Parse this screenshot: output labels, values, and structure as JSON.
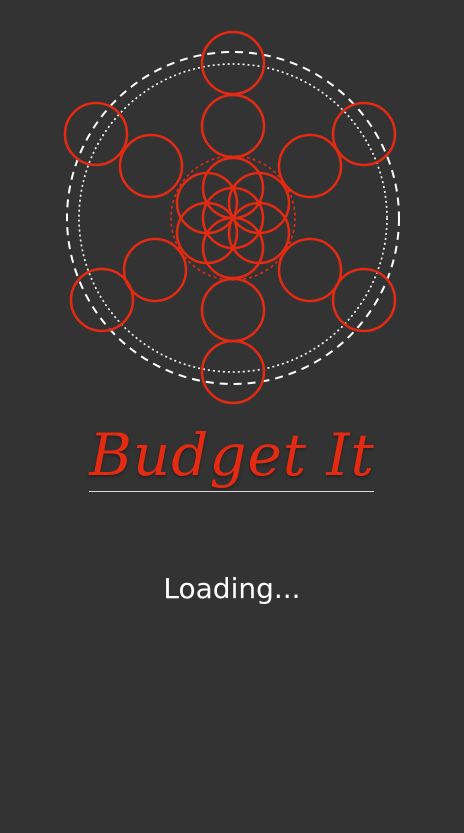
{
  "app": {
    "title": "Budget It",
    "loading_text": "Loading..."
  },
  "colors": {
    "background": "#333333",
    "accent": "#e52a12",
    "logo_ring": "#ffffff",
    "divider": "#d9d9d9",
    "text": "#ffffff"
  },
  "logo": {
    "icon": "sacred-geometry-logo-icon"
  }
}
